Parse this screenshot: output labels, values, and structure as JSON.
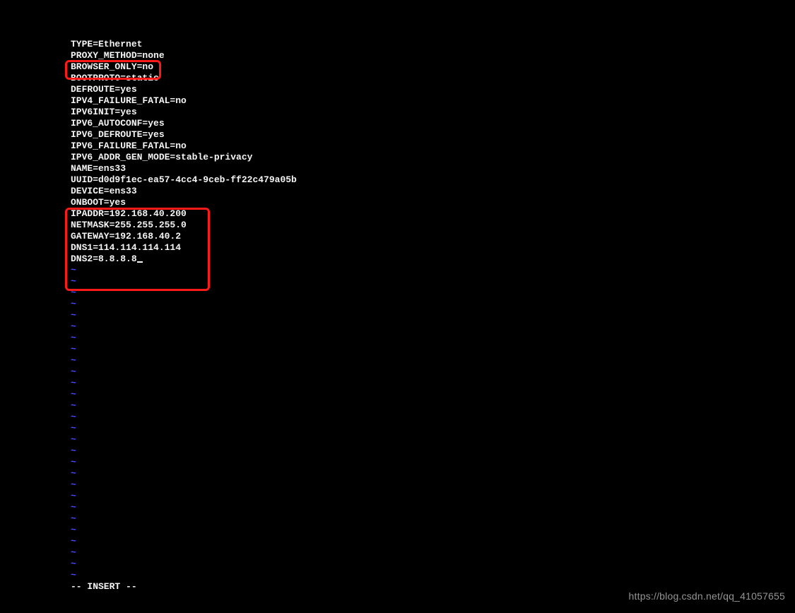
{
  "editor": {
    "mode_line": "-- INSERT --"
  },
  "config_lines": [
    "TYPE=Ethernet",
    "PROXY_METHOD=none",
    "BROWSER_ONLY=no",
    "BOOTPROTO=static",
    "DEFROUTE=yes",
    "IPV4_FAILURE_FATAL=no",
    "IPV6INIT=yes",
    "IPV6_AUTOCONF=yes",
    "IPV6_DEFROUTE=yes",
    "IPV6_FAILURE_FATAL=no",
    "IPV6_ADDR_GEN_MODE=stable-privacy",
    "NAME=ens33",
    "UUID=d0d9f1ec-ea57-4cc4-9ceb-ff22c479a05b",
    "DEVICE=ens33",
    "ONBOOT=yes",
    "IPADDR=192.168.40.200",
    "NETMASK=255.255.255.0",
    "GATEWAY=192.168.40.2",
    "DNS1=114.114.114.114",
    "DNS2=8.8.8.8"
  ],
  "tilde_count": 28,
  "watermark": "https://blog.csdn.net/qq_41057655"
}
